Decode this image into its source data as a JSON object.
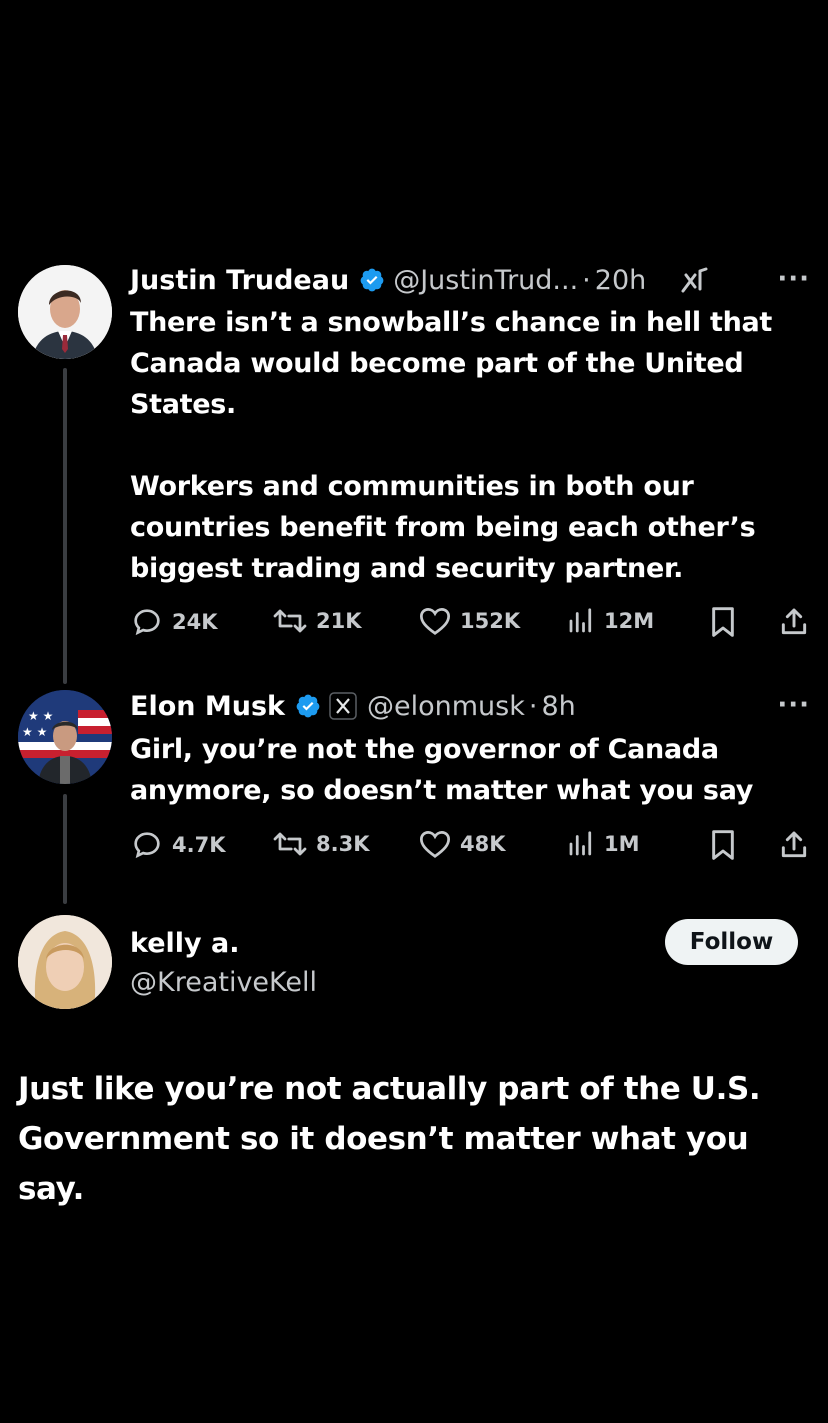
{
  "tweet1": {
    "name": "Justin Trudeau",
    "handle": "@JustinTrud...",
    "time": "20h",
    "more": "···",
    "paragraphs": [
      "There isn’t a snowball’s chance in hell that Canada would become part of the United States.",
      "Workers and communities in both our countries benefit from being each other’s biggest trading and security partner."
    ],
    "stats": {
      "replies": "24K",
      "reposts": "21K",
      "likes": "152K",
      "views": "12M"
    }
  },
  "tweet2": {
    "name": "Elon Musk",
    "handle": "@elonmusk",
    "time": "8h",
    "more": "···",
    "text": "Girl, you’re not the governor of Canada anymore, so doesn’t matter what you say",
    "stats": {
      "replies": "4.7K",
      "reposts": "8.3K",
      "likes": "48K",
      "views": "1M"
    }
  },
  "tweet3": {
    "name": "kelly a.",
    "handle": "@KreativeKell",
    "follow_label": "Follow",
    "text": "Just like you’re not actually part of the U.S. Government so it doesn’t matter what you say."
  },
  "colors": {
    "background": "#000000",
    "text": "#e7e9ea",
    "verified": "#1d9bf0",
    "muted": "#c6c9cc"
  },
  "dot": "·"
}
